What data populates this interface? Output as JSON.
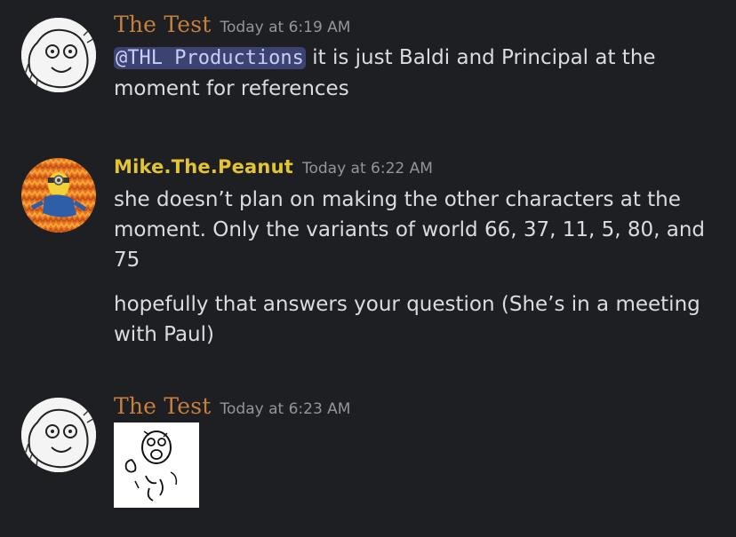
{
  "messages": [
    {
      "username": "The Test",
      "timestamp": "Today at 6:19 AM",
      "mention": "@THL Productions",
      "text_after_mention": " it is just Baldi and Principal at the moment for references"
    },
    {
      "username": "Mike.The.Peanut",
      "timestamp": "Today at 6:22 AM",
      "lines": [
        "she doesn’t plan on making the other characters at the moment. Only the variants of world 66, 37, 11, 5, 80, and 75",
        "hopefully that answers your question (She’s in a meeting with Paul)"
      ]
    },
    {
      "username": "The Test",
      "timestamp": "Today at 6:23 AM"
    }
  ],
  "colors": {
    "background": "#1e1f23",
    "username_test": "#c6803b",
    "username_mike": "#e3c432",
    "mention_bg": "#3c4370",
    "mention_text": "#c9cdfb",
    "timestamp": "#94959c"
  },
  "icons": [
    "sketch-avatar-icon",
    "minion-avatar-icon",
    "sketch-sticker-image"
  ]
}
